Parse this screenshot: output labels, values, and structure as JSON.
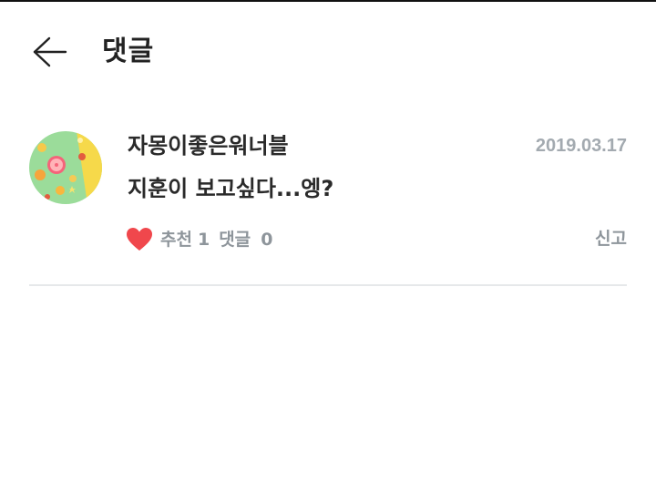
{
  "header": {
    "title": "댓글",
    "back_icon": "arrow-left-icon"
  },
  "comment": {
    "author": "자몽이좋은워너블",
    "date": "2019.03.17",
    "text": "지훈이 보고싶다...엥?",
    "recommend_label": "추천",
    "recommend_count": "1",
    "reply_label": "댓글",
    "reply_count": "0",
    "report_label": "신고",
    "like_icon": "heart-icon",
    "avatar_icon": "citrus-fruit-avatar"
  },
  "colors": {
    "heart": "#f0474c",
    "date": "#a3aab0",
    "meta_text": "#8e959b",
    "divider": "#e6e8ea",
    "title": "#222222"
  }
}
